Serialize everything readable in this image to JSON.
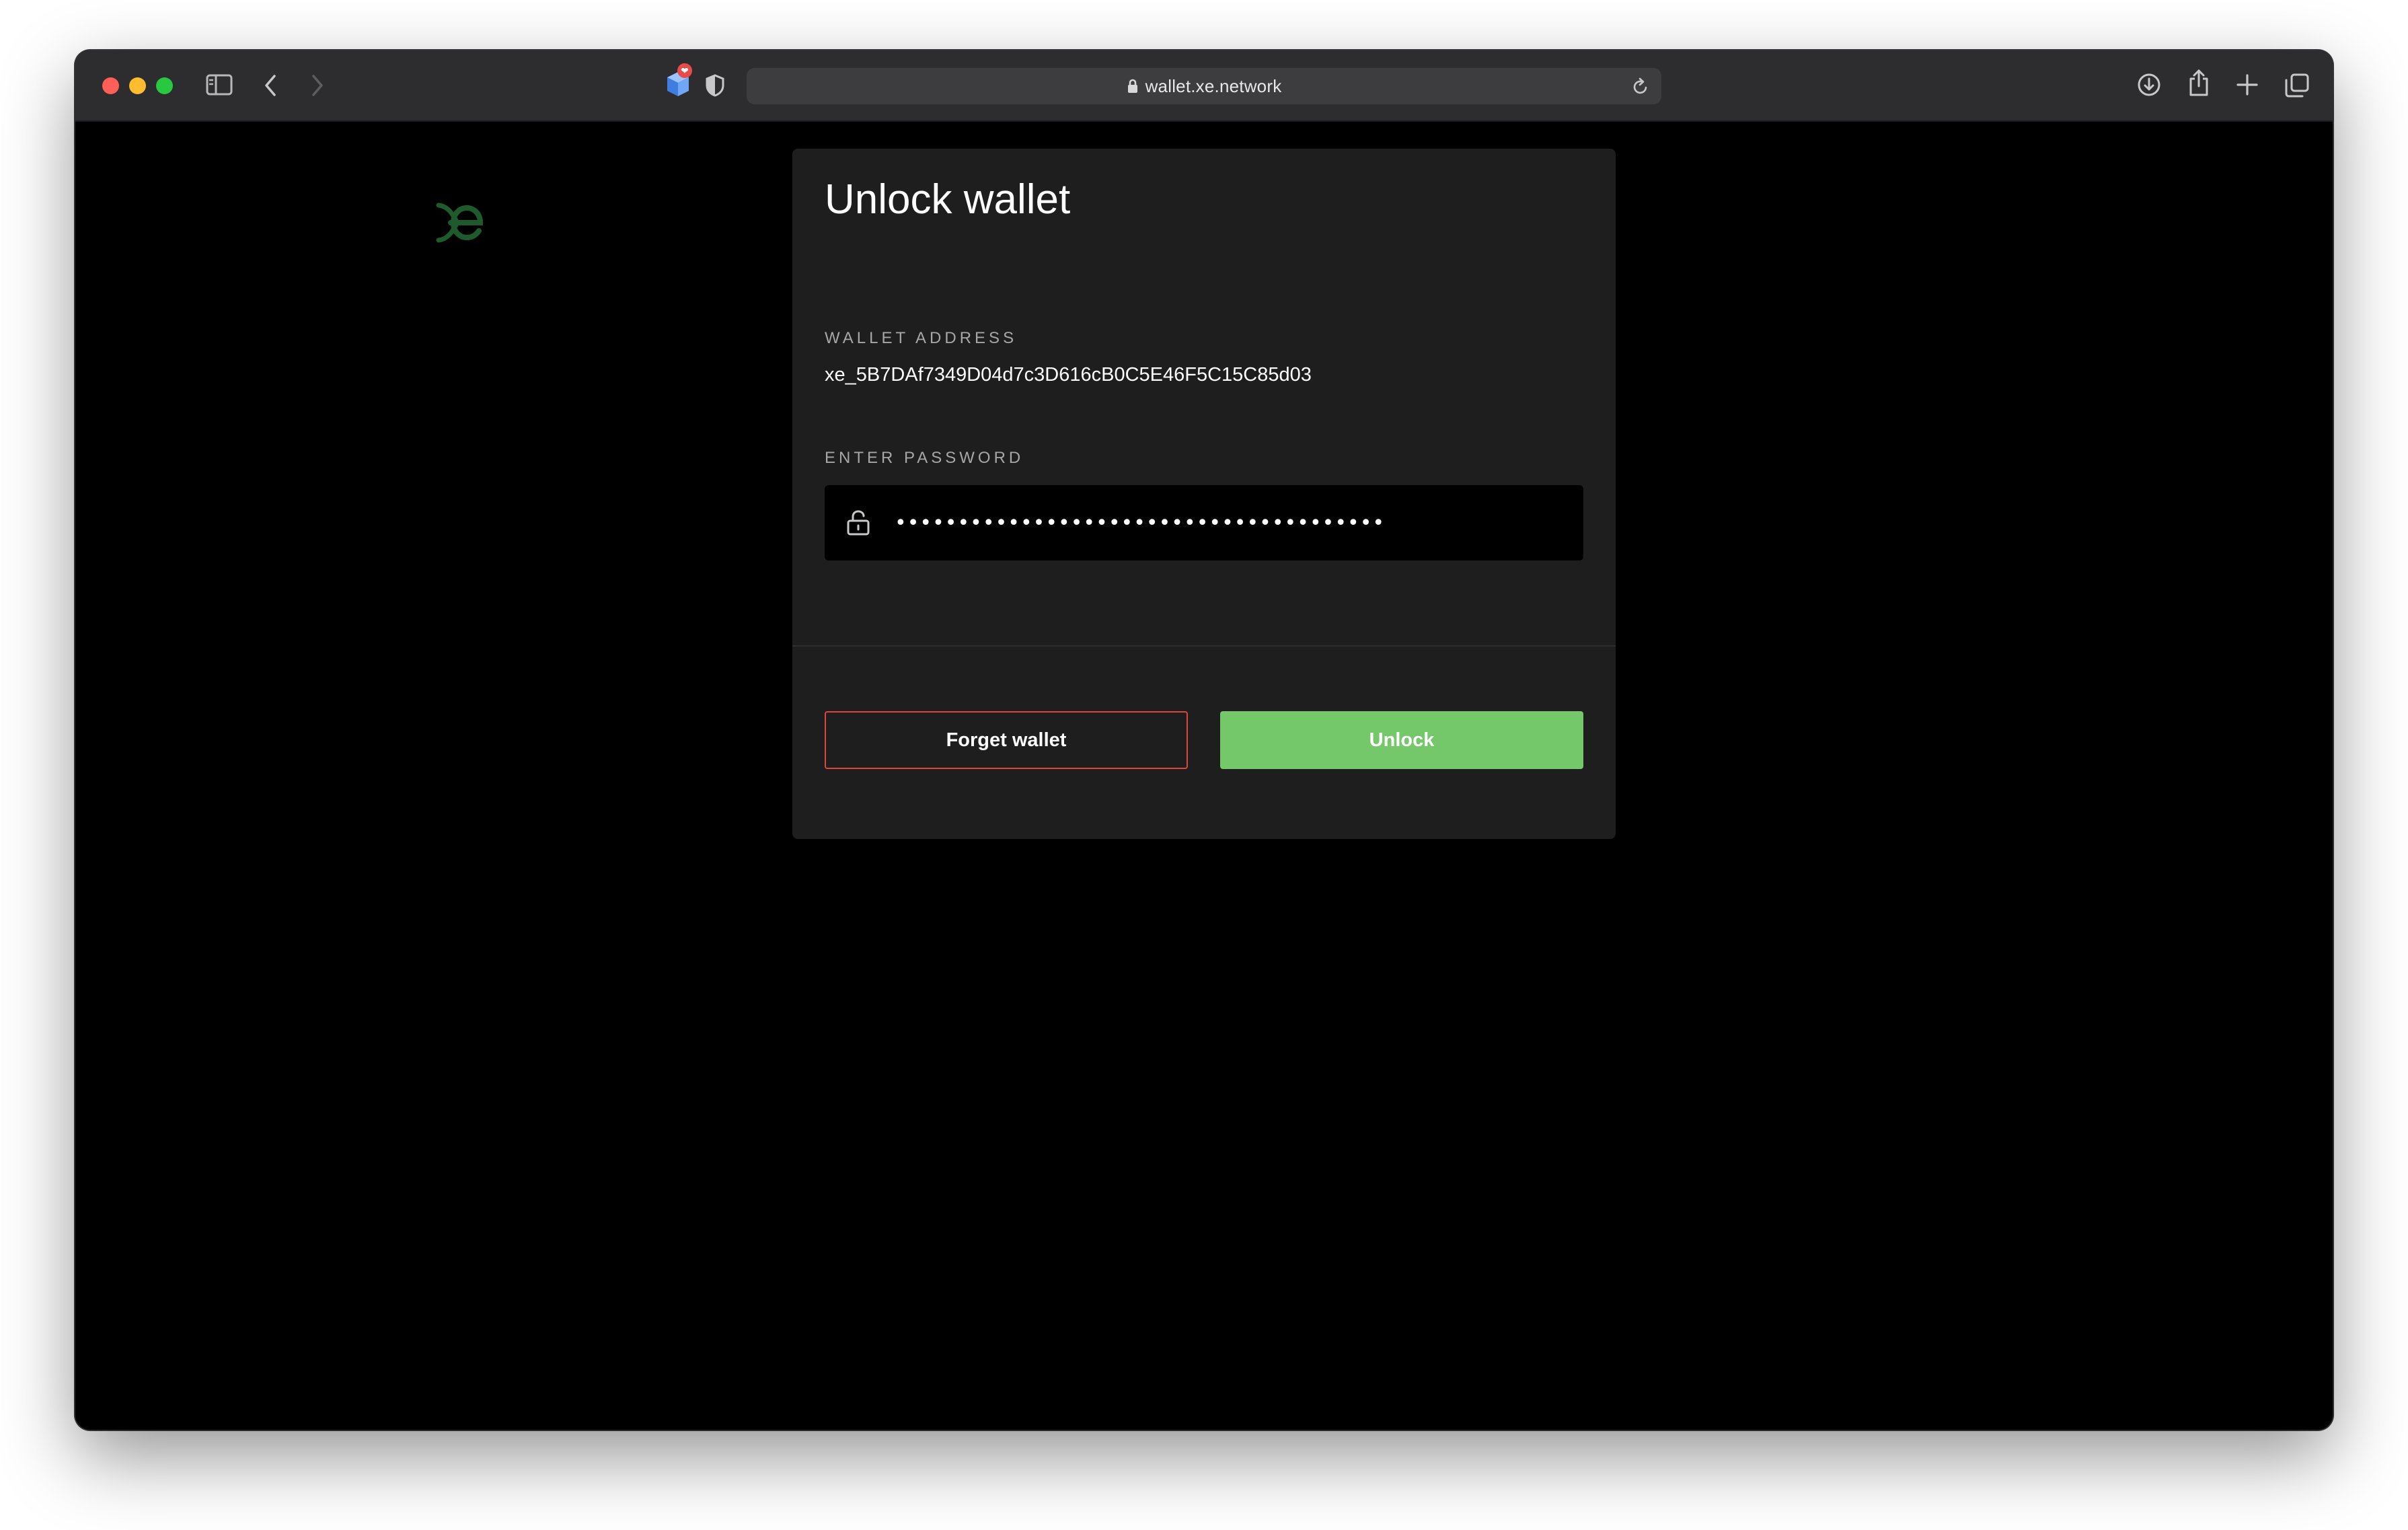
{
  "browser": {
    "url": "wallet.xe.network",
    "extension_badge": "❤"
  },
  "icons": {
    "sidebar": "sidebar-icon",
    "back": "chevron-left-icon",
    "forward": "chevron-right-icon",
    "extension": "cube-icon",
    "privacy": "shield-icon",
    "lock": "lock-icon",
    "reload": "reload-icon",
    "downloads": "download-icon",
    "share": "share-icon",
    "new_tab": "plus-icon",
    "tab_overview": "tabs-icon",
    "password_lock": "unlocked-padlock-icon"
  },
  "colors": {
    "accent_green": "#74c869",
    "danger_red": "#e0463d",
    "logo_green": "#1f5a2c",
    "card_bg": "#1e1e1e"
  },
  "card": {
    "title": "Unlock wallet",
    "wallet_address_label": "WALLET ADDRESS",
    "wallet_address": "xe_5B7DAf7349D04d7c3D616cB0C5E46F5C15C85d03",
    "password_label": "ENTER PASSWORD",
    "password_value": "•••••••••••••••••••••••••••••••••••••••",
    "forget_button": "Forget wallet",
    "unlock_button": "Unlock"
  }
}
